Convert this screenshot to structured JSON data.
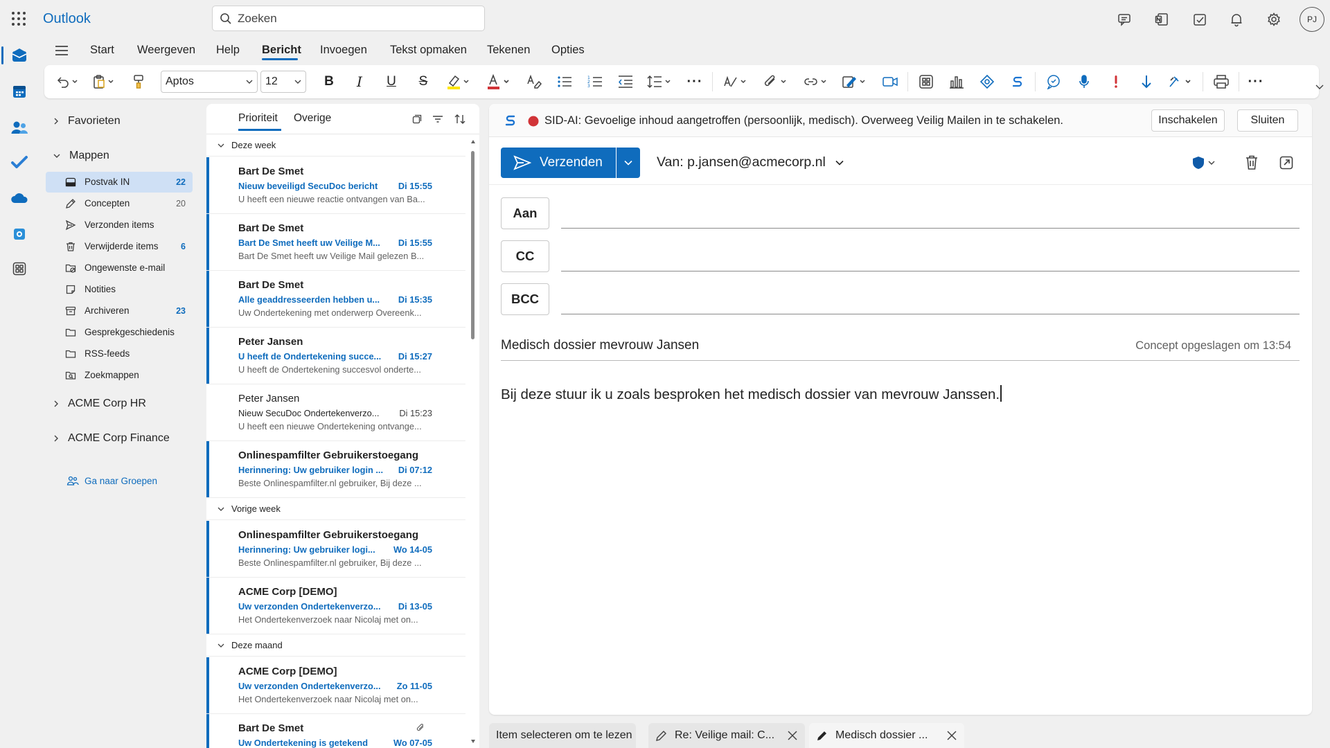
{
  "app": {
    "name": "Outlook",
    "avatar_initials": "PJ",
    "accent": "#0f6cbd"
  },
  "search": {
    "placeholder": "Zoeken"
  },
  "ribbon": {
    "tabs": [
      "Start",
      "Weergeven",
      "Help",
      "Bericht",
      "Invoegen",
      "Tekst opmaken",
      "Tekenen",
      "Opties"
    ],
    "active_tab": "Bericht",
    "font_name": "Aptos",
    "font_size": "12"
  },
  "folders": {
    "favorites_label": "Favorieten",
    "mappen_label": "Mappen",
    "items": [
      {
        "label": "Postvak IN",
        "count": "22",
        "icon": "inbox-icon",
        "selected": true
      },
      {
        "label": "Concepten",
        "count": "20",
        "icon": "pencil-icon"
      },
      {
        "label": "Verzonden items",
        "count": "",
        "icon": "send-icon"
      },
      {
        "label": "Verwijderde items",
        "count": "6",
        "icon": "trash-icon"
      },
      {
        "label": "Ongewenste e-mail",
        "count": "",
        "icon": "junk-icon"
      },
      {
        "label": "Notities",
        "count": "",
        "icon": "note-icon"
      },
      {
        "label": "Archiveren",
        "count": "23",
        "icon": "archive-icon"
      },
      {
        "label": "Gesprekgeschiedenis",
        "count": "",
        "icon": "folder-icon"
      },
      {
        "label": "RSS-feeds",
        "count": "",
        "icon": "folder-icon"
      },
      {
        "label": "Zoekmappen",
        "count": "",
        "icon": "search-folder-icon"
      }
    ],
    "group_hr": "ACME Corp HR",
    "group_finance": "ACME Corp Finance",
    "goto_groups": "Ga naar Groepen"
  },
  "message_list": {
    "tab_focused": "Prioriteit",
    "tab_other": "Overige",
    "groups": {
      "this_week": "Deze week",
      "last_week": "Vorige week",
      "this_month": "Deze maand"
    },
    "messages": [
      {
        "sender": "Bart De Smet",
        "subject": "Nieuw beveiligd SecuDoc bericht",
        "time": "Di 15:55",
        "preview": "U heeft een nieuwe reactie ontvangen van Ba...",
        "unread": true
      },
      {
        "sender": "Bart De Smet",
        "subject": "Bart De Smet heeft uw Veilige M...",
        "time": "Di 15:55",
        "preview": "Bart De Smet heeft uw Veilige Mail gelezen B...",
        "unread": true
      },
      {
        "sender": "Bart De Smet",
        "subject": "Alle geaddresseerden hebben u...",
        "time": "Di 15:35",
        "preview": "Uw Ondertekening met onderwerp Overeenk...",
        "unread": true
      },
      {
        "sender": "Peter Jansen",
        "subject": "U heeft de Ondertekening succe...",
        "time": "Di 15:27",
        "preview": "U heeft de Ondertekening succesvol onderte...",
        "unread": true
      },
      {
        "sender": "Peter Jansen",
        "subject": "Nieuw SecuDoc Ondertekenverzo...",
        "time": "Di 15:23",
        "preview": "U heeft een nieuwe Ondertekening ontvange...",
        "unread": false
      },
      {
        "sender": "Onlinespamfilter Gebruikerstoegang",
        "subject": "Herinnering: Uw gebruiker login ...",
        "time": "Di 07:12",
        "preview": "Beste Onlinespamfilter.nl gebruiker, Bij deze ...",
        "unread": true
      },
      {
        "sender": "Onlinespamfilter Gebruikerstoegang",
        "subject": "Herinnering: Uw gebruiker logi...",
        "time": "Wo 14-05",
        "preview": "Beste Onlinespamfilter.nl gebruiker, Bij deze ...",
        "unread": true
      },
      {
        "sender": "ACME Corp [DEMO]",
        "subject": "Uw verzonden Ondertekenverzo...",
        "time": "Di 13-05",
        "preview": "Het Ondertekenverzoek naar Nicolaj met on...",
        "unread": true
      },
      {
        "sender": "ACME Corp [DEMO]",
        "subject": "Uw verzonden Ondertekenverzo...",
        "time": "Zo 11-05",
        "preview": "Het Ondertekenverzoek naar Nicolaj met on...",
        "unread": true
      },
      {
        "sender": "Bart De Smet",
        "subject": "Uw Ondertekening is getekend",
        "time": "Wo 07-05",
        "preview": "",
        "unread": true,
        "attachment": true
      }
    ]
  },
  "compose": {
    "banner_text": "SID-AI: Gevoelige inhoud aangetroffen (persoonlijk, medisch). Overweeg Veilig Mailen in te schakelen.",
    "banner_enable": "Inschakelen",
    "banner_close": "Sluiten",
    "send_label": "Verzenden",
    "from_label": "Van: p.jansen@acmecorp.nl",
    "to_label": "Aan",
    "cc_label": "CC",
    "bcc_label": "BCC",
    "subject": "Medisch dossier mevrouw Jansen",
    "draft_saved": "Concept opgeslagen om 13:54",
    "body": "Bij deze stuur ik u zoals besproken het medisch dossier van mevrouw Janssen."
  },
  "bottom_tabs": [
    {
      "label": "Item selecteren om te lezen"
    },
    {
      "label": "Re: Veilige mail: C..."
    },
    {
      "label": "Medisch dossier ..."
    }
  ]
}
